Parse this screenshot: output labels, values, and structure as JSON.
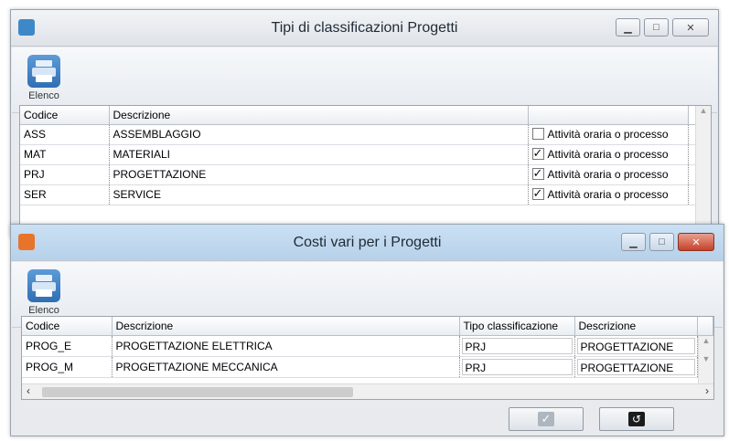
{
  "window1": {
    "title": "Tipi di classificazioni Progetti",
    "toolbar_label": "Elenco",
    "columns": [
      "Codice",
      "Descrizione",
      ""
    ],
    "rows": [
      {
        "code": "ASS",
        "desc": "ASSEMBLAGGIO",
        "flag_label": "Attività oraria o processo",
        "checked": false
      },
      {
        "code": "MAT",
        "desc": "MATERIALI",
        "flag_label": "Attività oraria o processo",
        "checked": true
      },
      {
        "code": "PRJ",
        "desc": "PROGETTAZIONE",
        "flag_label": "Attività oraria o processo",
        "checked": true
      },
      {
        "code": "SER",
        "desc": "SERVICE",
        "flag_label": "Attività oraria o processo",
        "checked": true
      }
    ]
  },
  "window2": {
    "title": "Costi vari per i Progetti",
    "toolbar_label": "Elenco",
    "columns": [
      "Codice",
      "Descrizione",
      "Tipo classificazione",
      "Descrizione"
    ],
    "rows": [
      {
        "code": "PROG_E",
        "desc": "PROGETTAZIONE ELETTRICA",
        "tipo": "PRJ",
        "desc2": "PROGETTAZIONE"
      },
      {
        "code": "PROG_M",
        "desc": "PROGETTAZIONE MECCANICA",
        "tipo": "PRJ",
        "desc2": "PROGETTAZIONE"
      }
    ],
    "ok_icon": "check-icon",
    "undo_icon": "undo-icon"
  },
  "colors": {
    "accent": "#2f6eb3",
    "close": "#c7412a"
  }
}
